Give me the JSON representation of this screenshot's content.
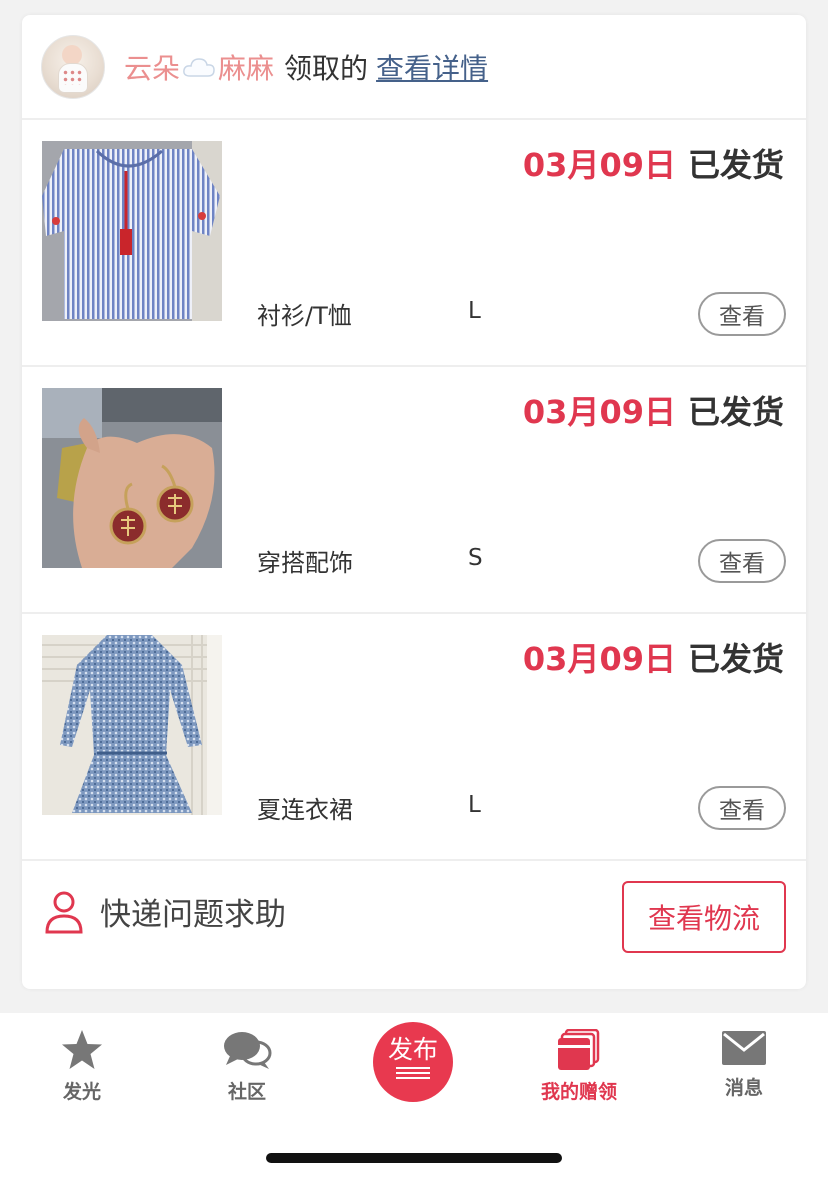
{
  "header": {
    "nickname_part1": "云朵",
    "nickname_part2": "麻麻",
    "claimed_text": "领取的",
    "detail_link": "查看详情"
  },
  "items": [
    {
      "date": "03月09日",
      "status": "已发货",
      "category": "衬衫/T恤",
      "size": "L",
      "view_label": "查看"
    },
    {
      "date": "03月09日",
      "status": "已发货",
      "category": "穿搭配饰",
      "size": "S",
      "view_label": "查看"
    },
    {
      "date": "03月09日",
      "status": "已发货",
      "category": "夏连衣裙",
      "size": "L",
      "view_label": "查看"
    }
  ],
  "help": {
    "label": "快递问题求助",
    "logistics_button": "查看物流"
  },
  "tabbar": {
    "tabs": [
      {
        "label": "发光",
        "icon": "star-icon"
      },
      {
        "label": "社区",
        "icon": "chat-bubbles-icon"
      },
      {
        "label": "发布",
        "icon": "publish-icon"
      },
      {
        "label": "我的赠领",
        "icon": "gift-cards-icon",
        "active": true
      },
      {
        "label": "消息",
        "icon": "envelope-icon"
      }
    ]
  },
  "colors": {
    "accent": "#e0374f",
    "nickname": "#eb8f8f",
    "link": "#45618a",
    "inactive_icon": "#777777"
  }
}
